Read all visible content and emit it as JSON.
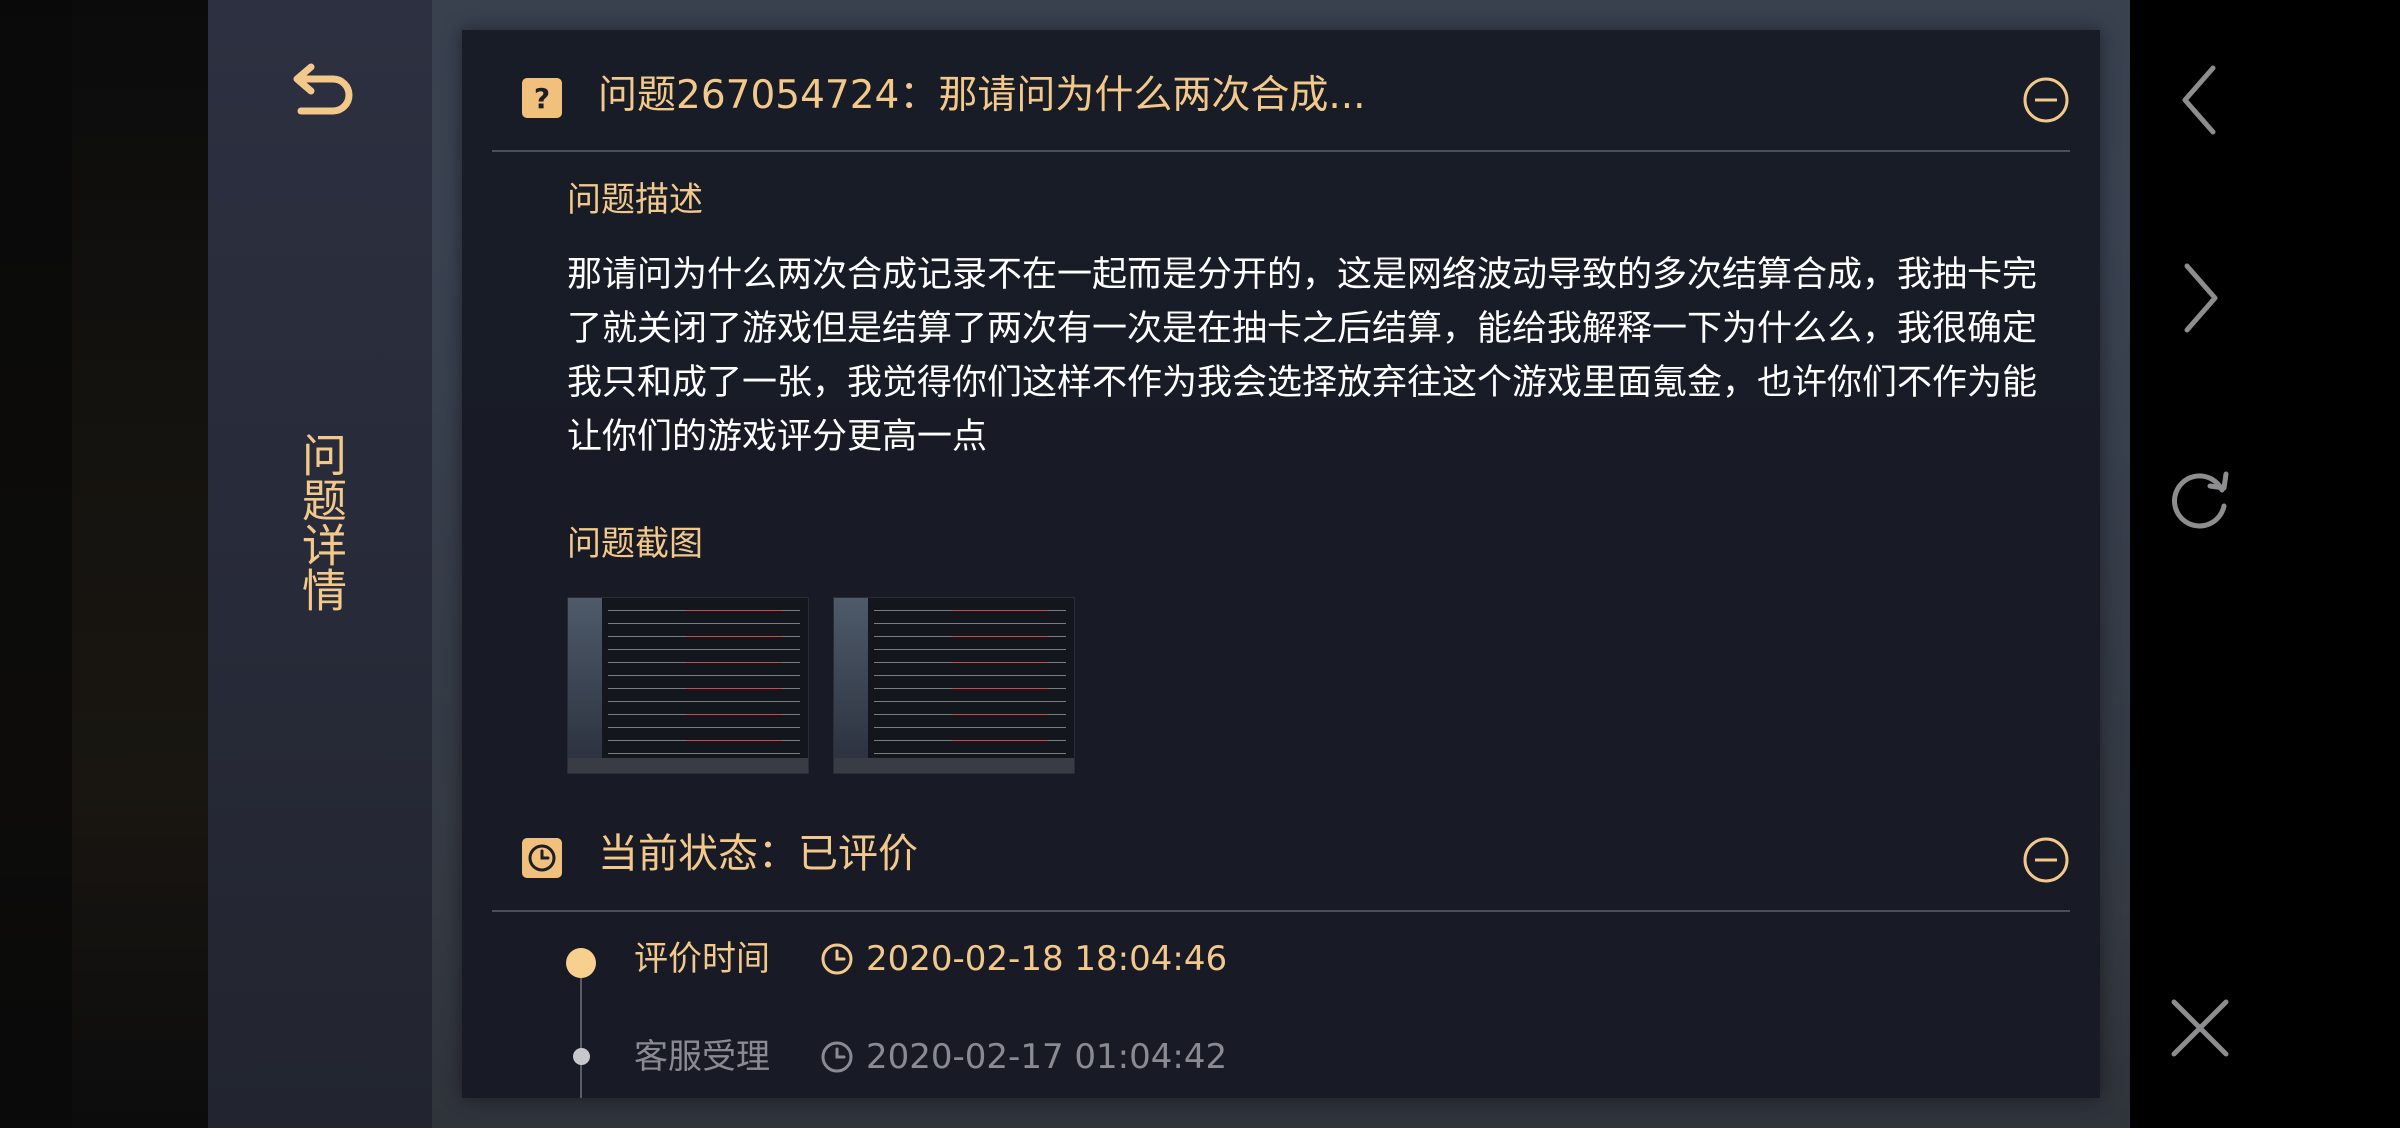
{
  "sidebar": {
    "title": "问题详情",
    "back_icon": "back-arrow-icon"
  },
  "question": {
    "header_title": "问题267054724：那请问为什么两次合成...",
    "icon": "question-icon",
    "description_heading": "问题描述",
    "description": "那请问为什么两次合成记录不在一起而是分开的，这是网络波动导致的多次结算合成，我抽卡完了就关闭了游戏但是结算了两次有一次是在抽卡之后结算，能给我解释一下为什么么，我很确定我只和成了一张，我觉得你们这样不作为我会选择放弃往这个游戏里面氪金，也许你们不作为能让你们的游戏评分更高一点",
    "screenshots_heading": "问题截图",
    "screenshots_count": 2
  },
  "status": {
    "header_title": "当前状态：已评价",
    "icon": "clock-icon",
    "timeline": [
      {
        "label": "评价时间",
        "time": "2020-02-18 18:04:46",
        "active": true
      },
      {
        "label": "客服受理",
        "time": "2020-02-17 01:04:42",
        "active": false
      }
    ]
  },
  "nav": [
    "chevron-left-icon",
    "chevron-right-icon",
    "refresh-icon",
    "close-icon"
  ],
  "colors": {
    "accent": "#f3c98b",
    "panel": "#161924",
    "text": "#ffffff",
    "muted": "#8a8b92"
  }
}
